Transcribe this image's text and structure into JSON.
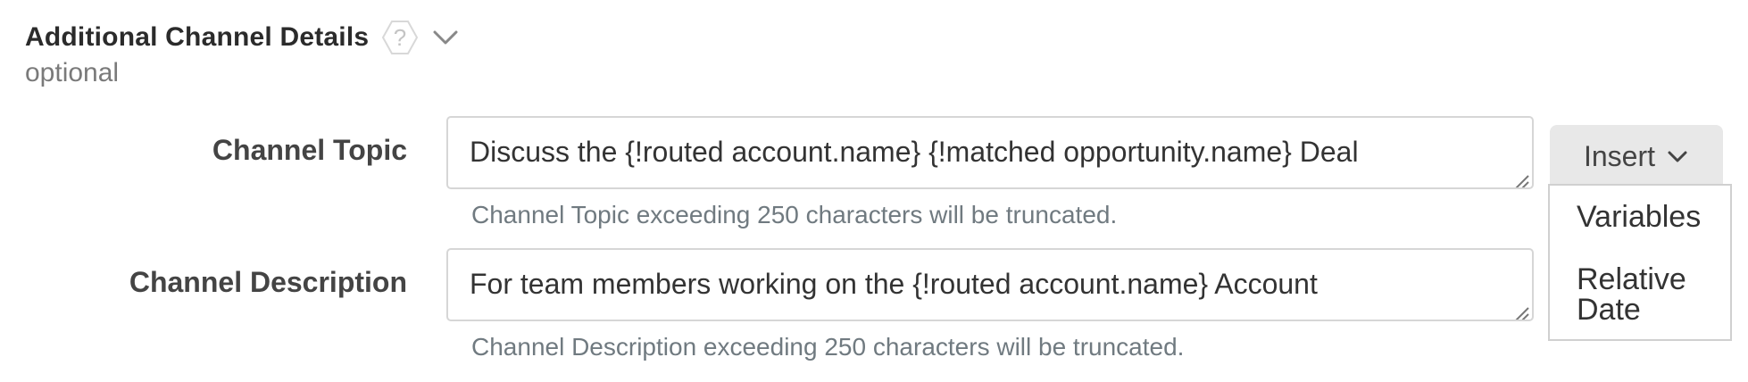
{
  "section": {
    "title": "Additional Channel Details",
    "subtitle": "optional",
    "help_icon": "help-hexagon-icon",
    "collapse_icon": "chevron-down-icon"
  },
  "fields": {
    "topic": {
      "label": "Channel Topic",
      "value": "Discuss the {!routed account.name} {!matched opportunity.name} Deal",
      "hint": "Channel Topic exceeding 250 characters will be truncated."
    },
    "description": {
      "label": "Channel Description",
      "value": "For team members working on the {!routed account.name} Account",
      "hint": "Channel Description exceeding 250 characters will be truncated."
    }
  },
  "insert_menu": {
    "button_label": "Insert",
    "chevron_icon": "chevron-down-icon",
    "items": [
      {
        "label": "Variables"
      },
      {
        "label": "Relative Date"
      }
    ]
  },
  "colors": {
    "title": "#2b2b2b",
    "subtitle": "#7a7a7a",
    "label": "#444444",
    "hint": "#707a80",
    "input_border": "#d6d6d6",
    "button_bg": "#e8e8e8"
  }
}
